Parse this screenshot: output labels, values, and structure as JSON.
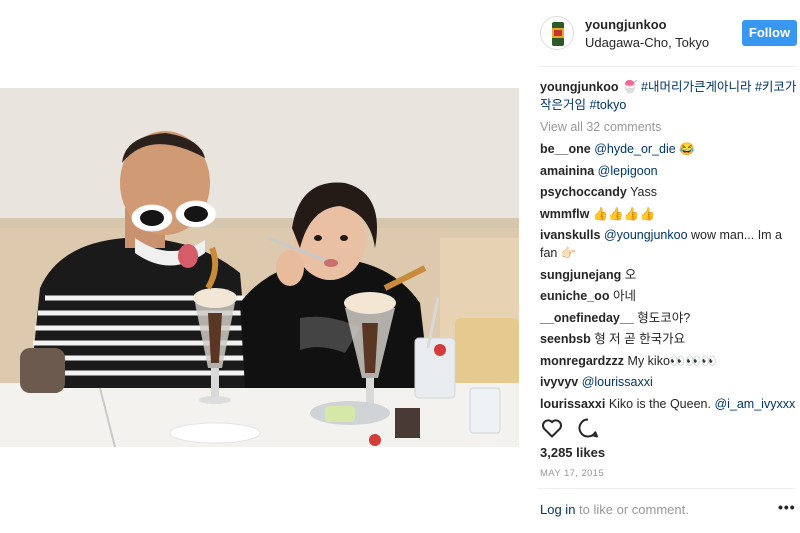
{
  "header": {
    "username": "youngjunkoo",
    "location": "Udagawa-Cho, Tokyo",
    "follow_label": "Follow"
  },
  "caption": {
    "username": "youngjunkoo",
    "emoji": "🍧",
    "hashtags_line1": "#내머리가큰게아니라 #키코가",
    "hashtags_line2a": "작은거임",
    "hashtags_line2b": "#tokyo"
  },
  "view_all_label": "View all 32 comments",
  "comments": [
    {
      "user": "be__one",
      "text": "",
      "mention": "@hyde_or_die",
      "after": " 😂"
    },
    {
      "user": "amainina",
      "text": "",
      "mention": "@lepigoon",
      "after": ""
    },
    {
      "user": "psychoccandy",
      "text": "Yass",
      "mention": "",
      "after": ""
    },
    {
      "user": "wmmflw",
      "text": "👍👍👍👍",
      "mention": "",
      "after": ""
    },
    {
      "user": "ivanskulls",
      "text": "",
      "mention": "@youngjunkoo",
      "after": " wow man... Im a fan 👉🏻"
    },
    {
      "user": "sungjunejang",
      "text": "오",
      "mention": "",
      "after": ""
    },
    {
      "user": "euniche_oo",
      "text": "아네",
      "mention": "",
      "after": ""
    },
    {
      "user": "__onefineday__",
      "text": "형도코야?",
      "mention": "",
      "after": ""
    },
    {
      "user": "seenbsb",
      "text": "형 저 곧 한국가요",
      "mention": "",
      "after": ""
    },
    {
      "user": "monregardzzz",
      "text": "My kiko👀👀👀",
      "mention": "",
      "after": ""
    },
    {
      "user": "ivyvyv",
      "text": "",
      "mention": "@lourissaxxi",
      "after": ""
    },
    {
      "user": "lourissaxxi",
      "text": "Kiko is the Queen. ",
      "mention": "@i_am_ivyxxx",
      "after": ""
    }
  ],
  "likes_label": "3,285 likes",
  "date_label": "MAY 17, 2015",
  "login": {
    "link": "Log in",
    "rest": " to like or comment."
  },
  "more_label": "•••",
  "icons": {
    "like": "heart-outline-icon",
    "comment": "speech-bubble-icon",
    "more": "more-options-icon"
  },
  "colors": {
    "follow_bg": "#3897f0",
    "link": "#003569",
    "muted": "#999999"
  }
}
